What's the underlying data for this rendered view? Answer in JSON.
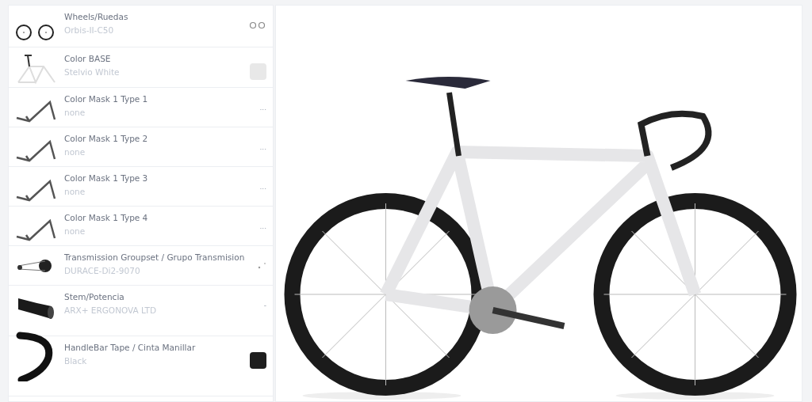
{
  "options": [
    {
      "kind": "wheels",
      "title": "Wheels/Ruedas",
      "value": "Orbis-II-C50",
      "trail": {
        "kind": "circles"
      }
    },
    {
      "kind": "frame",
      "title": "Color BASE",
      "value": "Stelvio White",
      "trail": {
        "kind": "swatch",
        "color": "#e8e8e8"
      }
    },
    {
      "kind": "mask",
      "title": "Color Mask 1 Type 1",
      "value": "none",
      "trail": {
        "kind": "text",
        "text": "..."
      }
    },
    {
      "kind": "mask",
      "title": "Color Mask 1 Type 2",
      "value": "none",
      "trail": {
        "kind": "text",
        "text": "..."
      }
    },
    {
      "kind": "mask",
      "title": "Color Mask 1 Type 3",
      "value": "none",
      "trail": {
        "kind": "text",
        "text": "..."
      }
    },
    {
      "kind": "mask",
      "title": "Color Mask 1 Type 4",
      "value": "none",
      "trail": {
        "kind": "text",
        "text": "..."
      }
    },
    {
      "kind": "groupset",
      "title": "Transmission Groupset / Grupo Transmision",
      "value": "DURACE-Di2-9070",
      "trail": {
        "kind": "mini"
      }
    },
    {
      "kind": "stem",
      "title": "Stem/Potencia",
      "value": "ARX+ ERGONOVA LTD",
      "trail": {
        "kind": "text",
        "text": "-"
      }
    },
    {
      "kind": "tape",
      "title": "HandleBar Tape / Cinta Manillar",
      "value": "Black",
      "trail": {
        "kind": "swatch",
        "color": "#1e1e1e"
      }
    }
  ]
}
